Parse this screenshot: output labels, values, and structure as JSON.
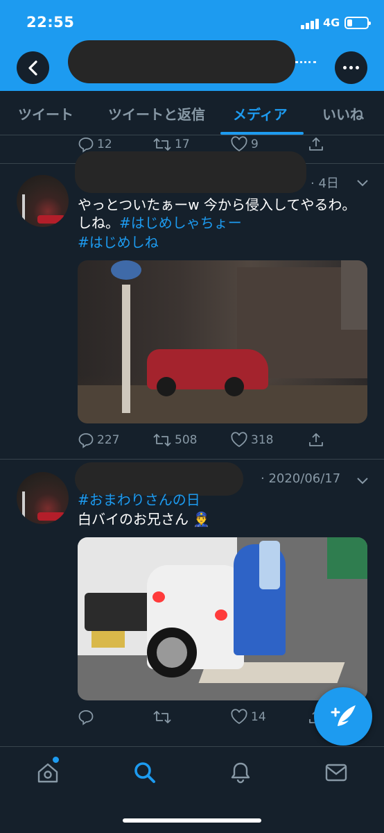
{
  "status_bar": {
    "time": "22:55",
    "network": "4G"
  },
  "header": {
    "back_icon": "chevron-left-icon",
    "more_icon": "more-horizontal-icon"
  },
  "tabs": [
    {
      "label": "ツイート",
      "active": false
    },
    {
      "label": "ツイートと返信",
      "active": false
    },
    {
      "label": "メディア",
      "active": true
    },
    {
      "label": "いいね",
      "active": false
    }
  ],
  "prev_tweet_actions": {
    "replies": "12",
    "retweets": "17",
    "likes": "9"
  },
  "tweets": [
    {
      "meta": "· 4日",
      "text_line1": "やっとついたぁーw 今から侵入してやるわ。",
      "text_line2_plain": "しね。",
      "hashtag1": "#はじめしゃちょー",
      "hashtag2": "#はじめしね",
      "actions": {
        "replies": "227",
        "retweets": "508",
        "likes": "318"
      }
    },
    {
      "meta": "· 2020/06/17",
      "hashtag1": "#おまわりさんの日",
      "text_line1": "白バイのお兄さん 👮‍♂️",
      "actions": {
        "replies": "",
        "retweets": "",
        "likes": "14"
      }
    }
  ],
  "colors": {
    "accent": "#1d9bf0",
    "background": "#15202b",
    "muted": "#8899a6",
    "divider": "#38444d"
  },
  "bottom_nav": [
    "home-icon",
    "search-icon",
    "bell-icon",
    "mail-icon"
  ],
  "fab_icon": "compose-tweet-icon"
}
